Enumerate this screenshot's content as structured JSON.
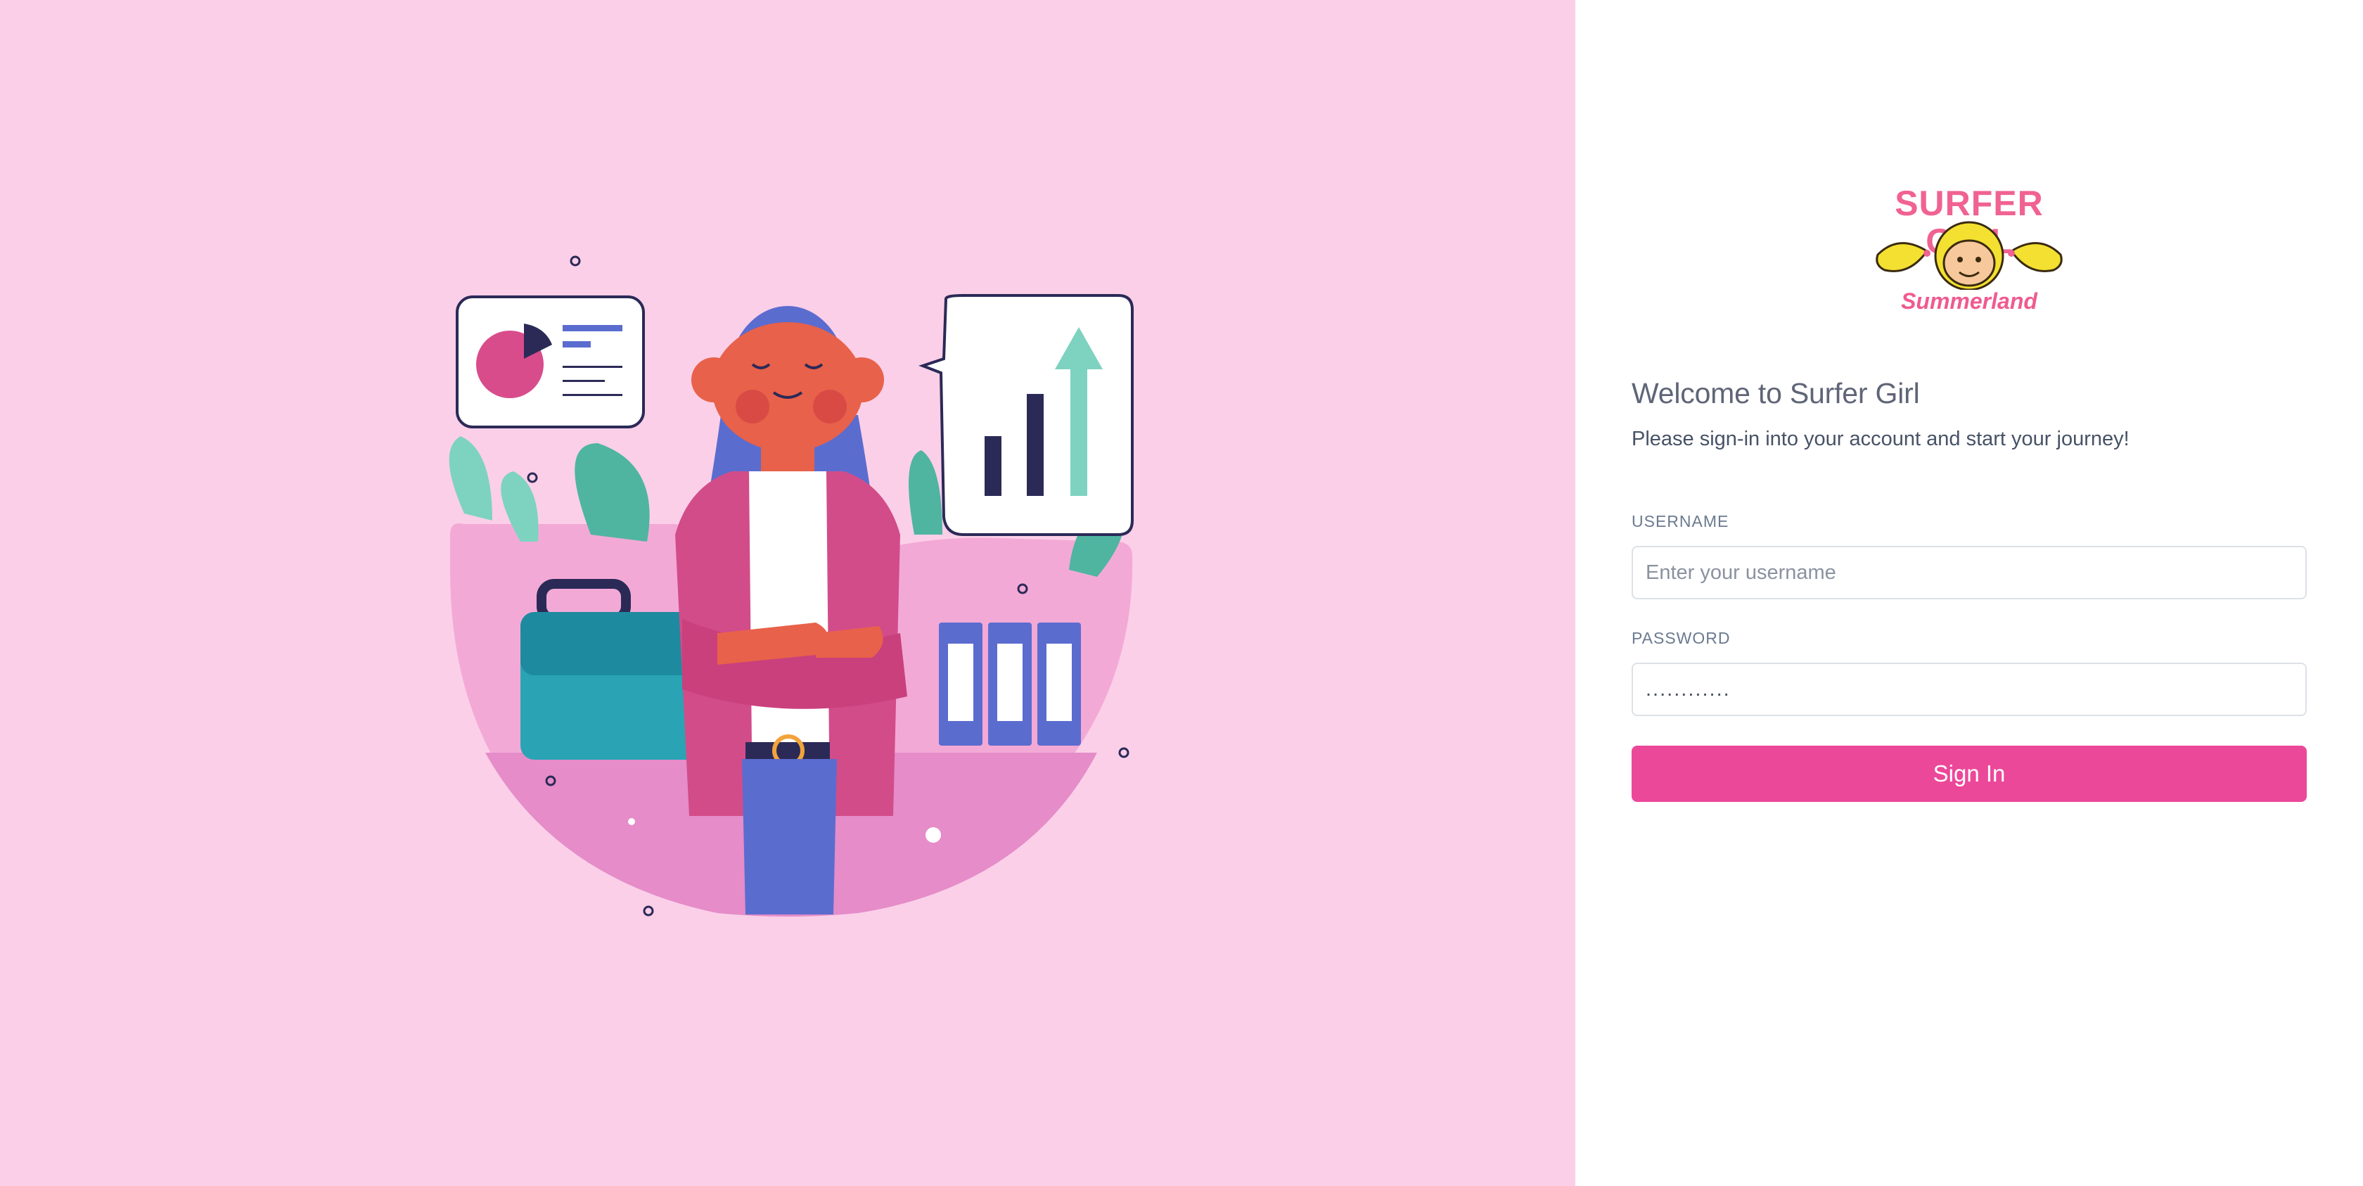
{
  "brand": {
    "wordmark": "SURFER GIRL",
    "subtitle": "Summerland",
    "logo_icon": "surfer-girl-face-logo",
    "accent_color": "#ec4899",
    "left_background": "#fbcfe8"
  },
  "illustration": {
    "icon": "woman-office-analytics-illustration"
  },
  "login": {
    "title": "Welcome to Surfer Girl",
    "subtitle": "Please sign-in into your account and start your journey!",
    "username_label": "USERNAME",
    "username_placeholder": "Enter your username",
    "password_label": "PASSWORD",
    "password_value": "............",
    "submit_label": "Sign In"
  }
}
